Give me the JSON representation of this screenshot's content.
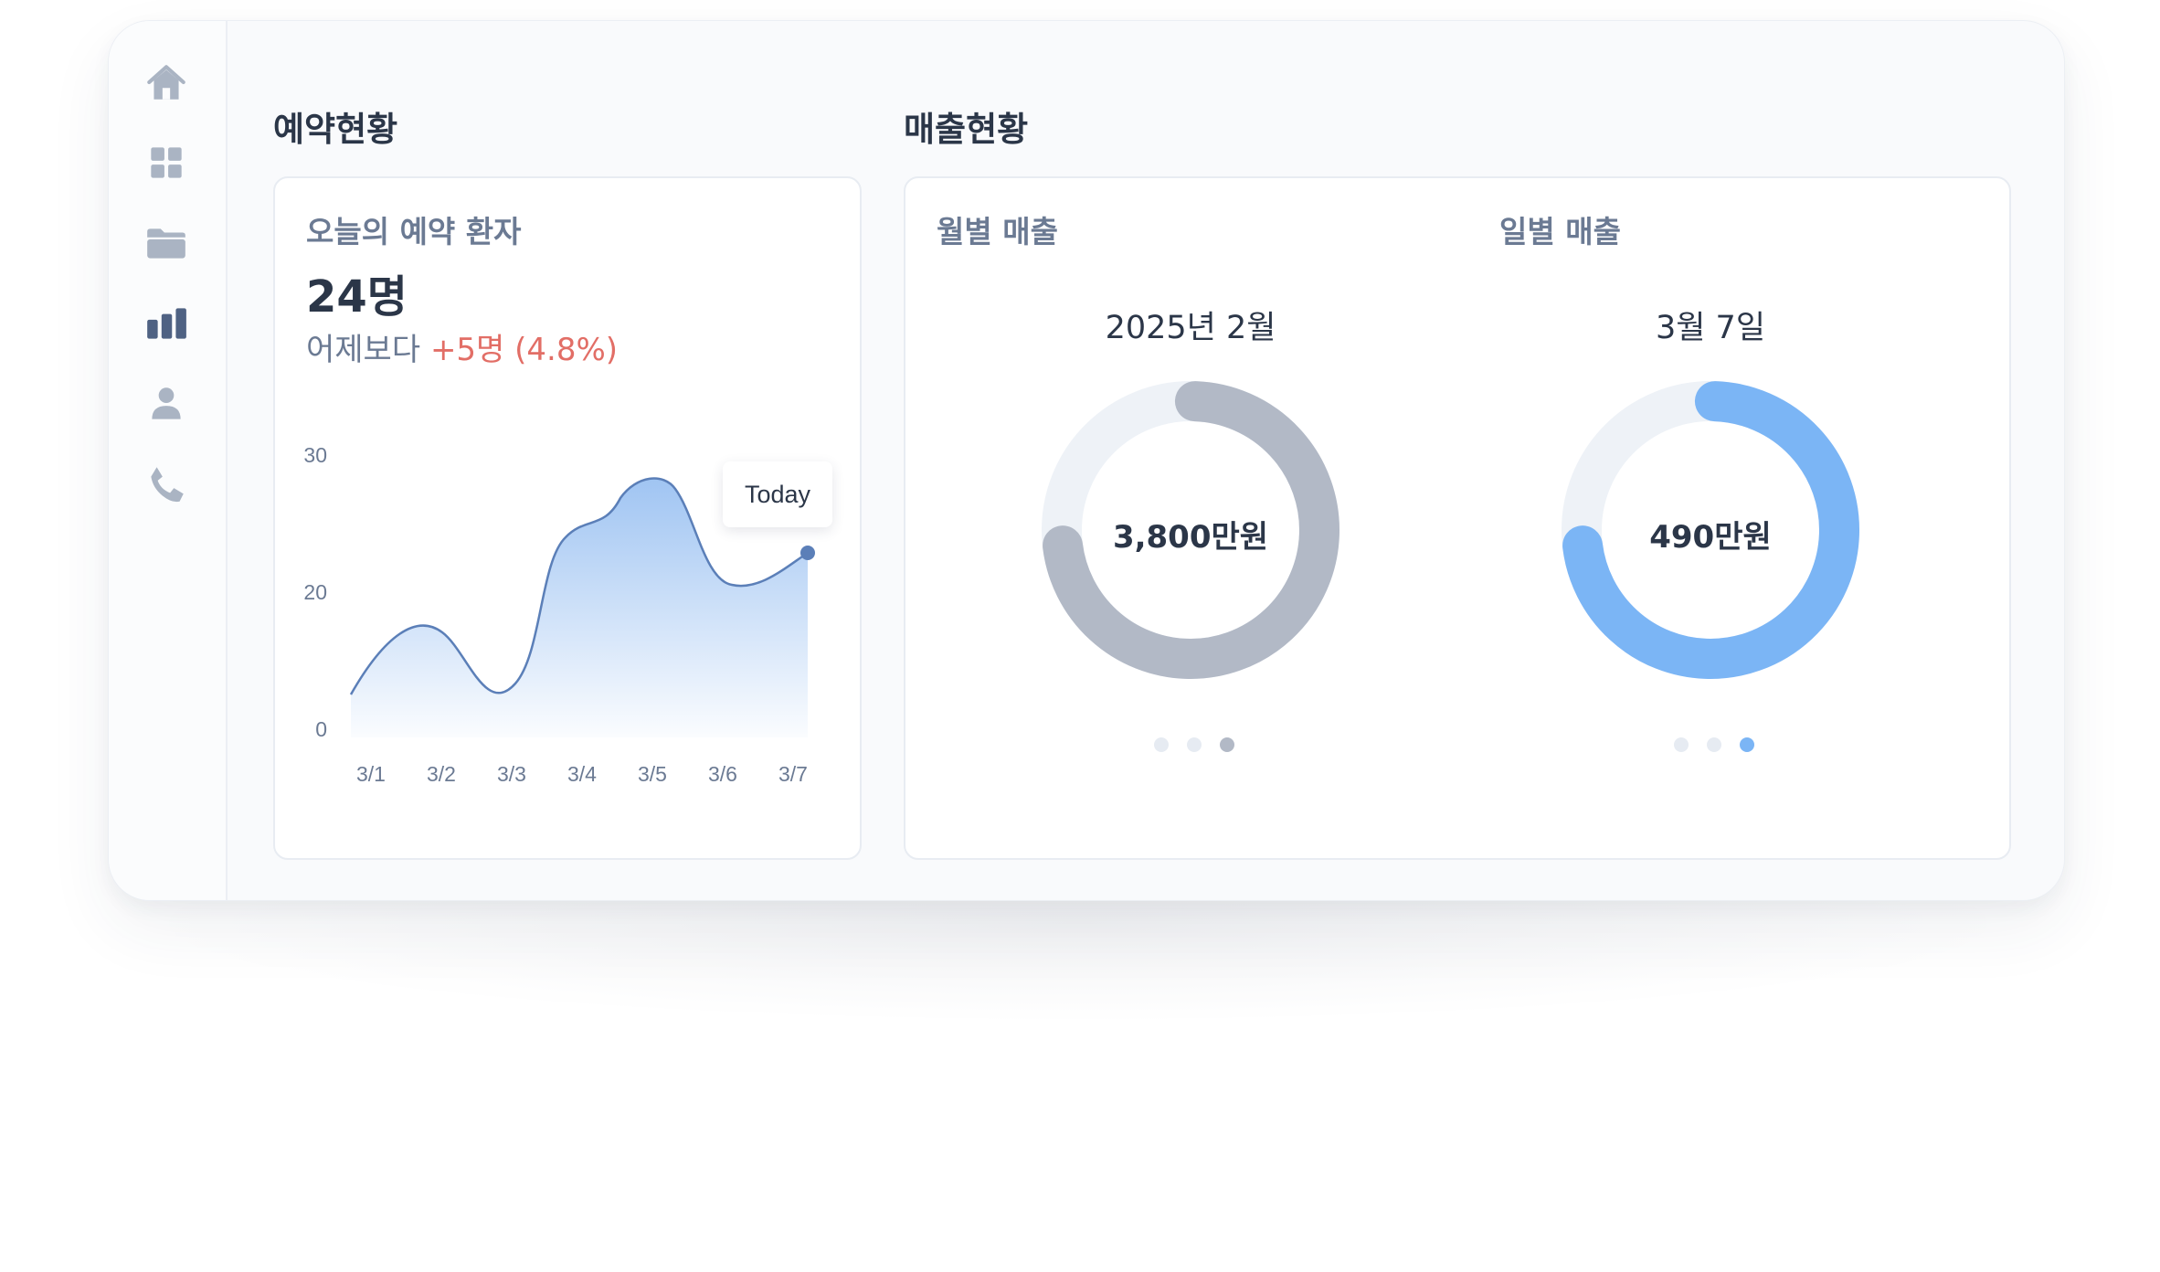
{
  "sidebar": {
    "items": [
      {
        "icon": "home-icon"
      },
      {
        "icon": "grid-icon"
      },
      {
        "icon": "folder-icon"
      },
      {
        "icon": "bar-chart-icon",
        "active": true
      },
      {
        "icon": "user-icon"
      },
      {
        "icon": "phone-icon"
      }
    ]
  },
  "reservation": {
    "section_title": "예약현황",
    "card_title": "오늘의 예약 환자",
    "count": "24명",
    "delta_prefix": "어제보다",
    "delta_value": "+5명 (4.8%)",
    "tooltip": "Today"
  },
  "sales": {
    "section_title": "매출현황",
    "monthly": {
      "label": "월별 매출",
      "period": "2025년 2월",
      "amount": "3,800만원",
      "dots": 3,
      "active_dot": 2
    },
    "daily": {
      "label": "일별 매출",
      "period": "3월 7일",
      "amount": "490만원",
      "dots": 3,
      "active_dot": 2
    }
  },
  "colors": {
    "accent": "#7bb5f5",
    "gray_ring": "#b2b9c6",
    "track": "#eef2f7",
    "line": "#5b7fb8",
    "delta_up": "#e26e66",
    "text_dark": "#2b3648",
    "text_muted": "#6b7a93"
  },
  "chart_data": {
    "type": "area",
    "x": [
      "3/1",
      "3/2",
      "3/3",
      "3/4",
      "3/5",
      "3/6",
      "3/7"
    ],
    "ticks_y": [
      0,
      20,
      30
    ],
    "highlight": "3/7"
  }
}
